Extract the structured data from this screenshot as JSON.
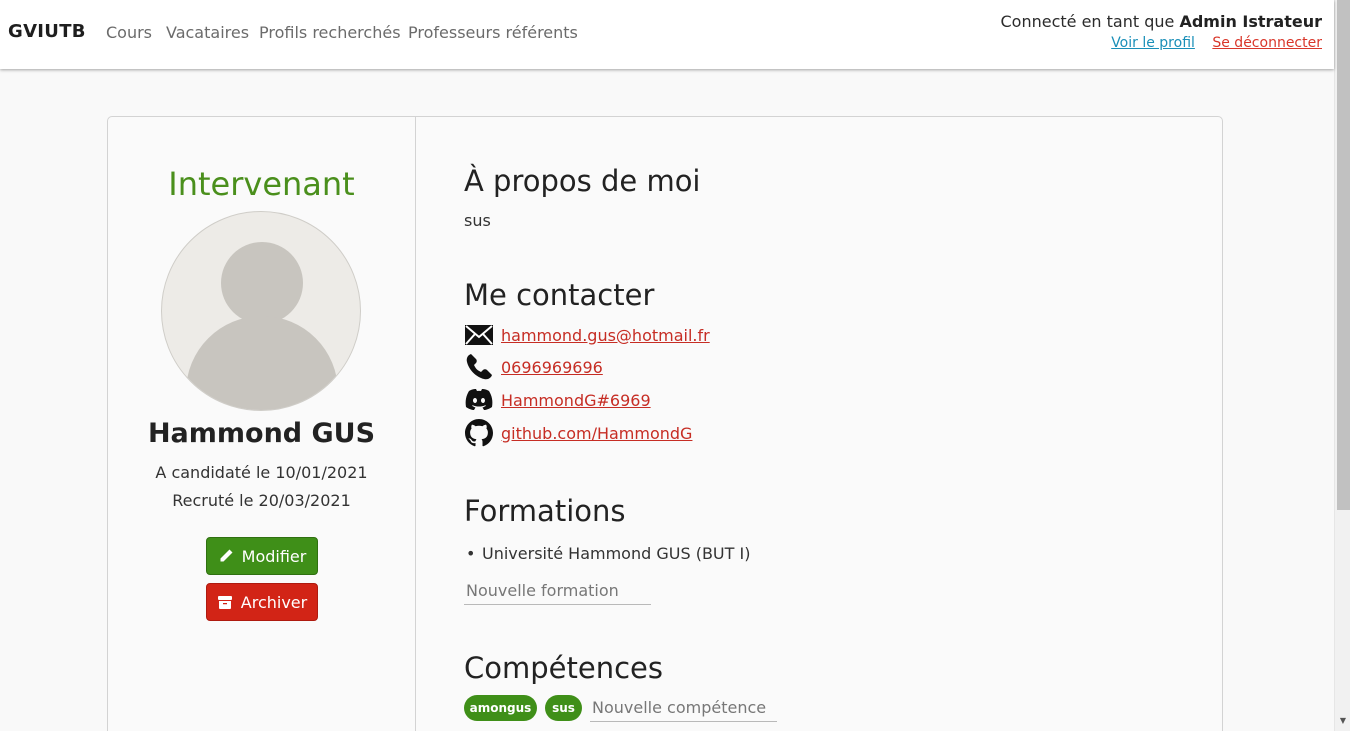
{
  "navbar": {
    "brand": "GVIUTB",
    "links": [
      "Cours",
      "Vacataires",
      "Profils recherchés",
      "Professeurs référents"
    ],
    "connected_prefix": "Connecté en tant que",
    "user_name": "Admin Istrateur",
    "view_profile": "Voir le profil",
    "logout": "Se déconnecter"
  },
  "profile": {
    "role": "Intervenant",
    "name": "Hammond GUS",
    "applied": "A candidaté le 10/01/2021",
    "recruited": "Recruté le 20/03/2021",
    "edit_label": "Modifier",
    "archive_label": "Archiver"
  },
  "about": {
    "title": "À propos de moi",
    "text": "sus"
  },
  "contact": {
    "title": "Me contacter",
    "email": "hammond.gus@hotmail.fr",
    "phone": "0696969696",
    "discord": "HammondG#6969",
    "github": "github.com/HammondG"
  },
  "formations": {
    "title": "Formations",
    "items": [
      "Université Hammond GUS (BUT I)"
    ],
    "placeholder": "Nouvelle formation"
  },
  "skills": {
    "title": "Compétences",
    "tags": [
      "amongus",
      "sus"
    ],
    "placeholder": "Nouvelle compétence"
  },
  "colors": {
    "accent_green": "#3f8f18",
    "danger_red": "#d22416",
    "link_blue": "#1a8fb8",
    "link_red": "#c62d24"
  }
}
